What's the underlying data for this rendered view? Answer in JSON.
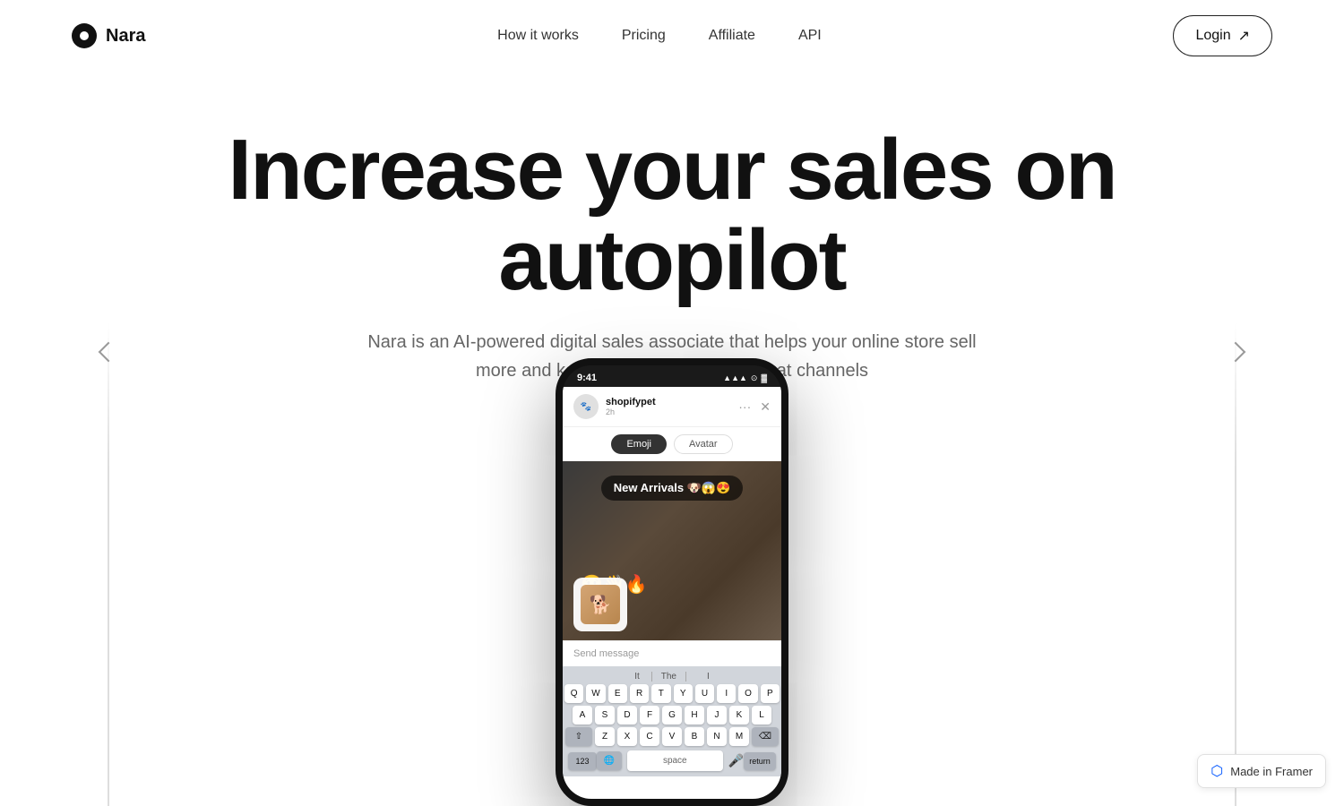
{
  "brand": {
    "name": "Nara",
    "logo_alt": "Nara logo"
  },
  "navbar": {
    "how_it_works": "How it works",
    "pricing": "Pricing",
    "affiliate": "Affiliate",
    "api": "API",
    "login": "Login"
  },
  "hero": {
    "title": "Increase your sales on autopilot",
    "subtitle": "Nara is an AI-powered digital sales associate that helps your online store sell more and keep clients happy on all chat channels"
  },
  "phone": {
    "status_time": "9:41",
    "status_signal": "▲▲▲",
    "status_wifi": "wifi",
    "status_battery": "battery",
    "chat_user": "shopifypet",
    "chat_time_ago": "2h",
    "tab_emoji": "Emoji",
    "tab_avatar": "Avatar",
    "story_title": "New Arrivals 🐶😱😍",
    "emojis": "😢👋🔥",
    "send_placeholder": "Send message",
    "kb_row1": [
      "Q",
      "W",
      "E",
      "R",
      "T",
      "Y",
      "U",
      "I",
      "O",
      "P"
    ],
    "kb_row2": [
      "A",
      "S",
      "D",
      "F",
      "G",
      "H",
      "J",
      "K",
      "L"
    ],
    "kb_row3": [
      "Z",
      "X",
      "C",
      "V",
      "B",
      "N",
      "M"
    ],
    "kb_word1": "It",
    "kb_word2": "The",
    "kb_word3": "I"
  },
  "framer_badge": {
    "text": "Made in Framer"
  }
}
